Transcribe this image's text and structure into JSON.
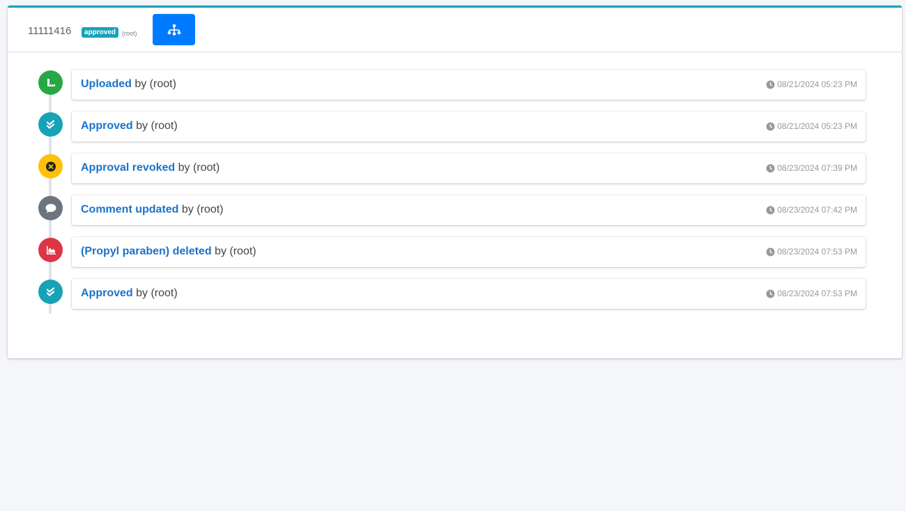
{
  "header": {
    "doc_id": "11111416",
    "status_badge": "approved",
    "owner": "(root)",
    "tree_button_icon": "sitemap-icon"
  },
  "colors": {
    "accent": "#17a2b8",
    "primary": "#007bff",
    "success": "#28a745",
    "warning": "#ffc107",
    "secondary": "#6c757d",
    "danger": "#dc3545",
    "link": "#1a73c9"
  },
  "timeline": [
    {
      "action": "Uploaded",
      "by": " by (root)",
      "time": "08/21/2024 05:23 PM",
      "icon": "upload-icon",
      "color": "#28a745"
    },
    {
      "action": "Approved",
      "by": " by (root)",
      "time": "08/21/2024 05:23 PM",
      "icon": "check-double-icon",
      "color": "#17a2b8"
    },
    {
      "action": "Approval revoked",
      "by": " by (root)",
      "time": "08/23/2024 07:39 PM",
      "icon": "times-circle-icon",
      "color": "#ffc107"
    },
    {
      "action": "Comment updated",
      "by": " by (root)",
      "time": "08/23/2024 07:42 PM",
      "icon": "comment-icon",
      "color": "#6c757d"
    },
    {
      "action": "(Propyl paraben) deleted",
      "by": " by (root)",
      "time": "08/23/2024 07:53 PM",
      "icon": "chart-area-icon",
      "color": "#dc3545"
    },
    {
      "action": "Approved",
      "by": " by (root)",
      "time": "08/23/2024 07:53 PM",
      "icon": "check-double-icon",
      "color": "#17a2b8"
    }
  ]
}
